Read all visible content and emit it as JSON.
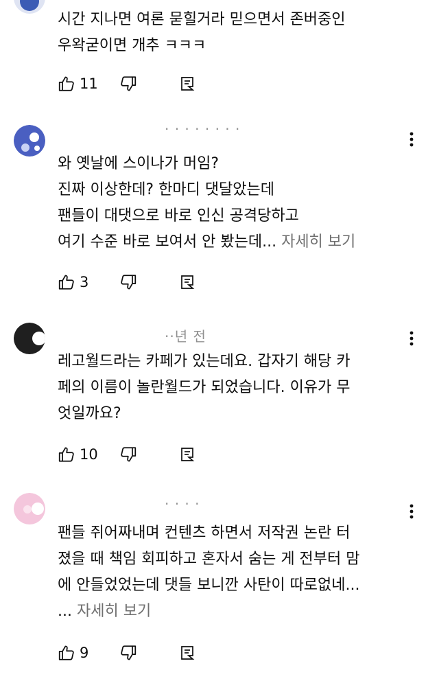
{
  "comments": [
    {
      "lines": [
        "시간 지나면 여론 묻힐거라 믿으면서 존버중인",
        "우왁굳이면 개추 ㅋㅋㅋ"
      ],
      "read_more": "",
      "likes": "11",
      "avatar_color": "#3b5bb5"
    },
    {
      "lines": [
        "와 옛날에 스이나가 머임?",
        "진짜 이상한데? 한마디 댓달았는데",
        "팬들이 대댓으로 바로 인신 공격당하고",
        "여기 수준 바로 보여서 안 봤는데..."
      ],
      "read_more": "자세히 보기",
      "likes": "3",
      "avatar_color": "#4a5fc1"
    },
    {
      "time": "··년 전",
      "lines": [
        "레고월드라는 카페가 있는데요. 갑자기 해당 카",
        "페의 이름이 놀란월드가 되었습니다. 이유가 무",
        "엇일까요?"
      ],
      "read_more": "",
      "likes": "10",
      "avatar_color": "#1f1f1f"
    },
    {
      "lines": [
        "팬들 쥐어짜내며 컨텐츠 하면서 저작권 논란 터",
        "졌을 때 책임 회피하고 혼자서 숨는 게 전부터 맘",
        "에 안들었었는데 댓들 보니깐 사탄이 따로없네..."
      ],
      "read_more_prefix": "... ",
      "read_more": "자세히 보기",
      "likes": "9",
      "avatar_color": "#f4c6dc"
    }
  ],
  "icons": {
    "like": "thumbs-up-icon",
    "dislike": "thumbs-down-icon",
    "reply": "reply-icon",
    "more": "more-vertical-icon"
  }
}
